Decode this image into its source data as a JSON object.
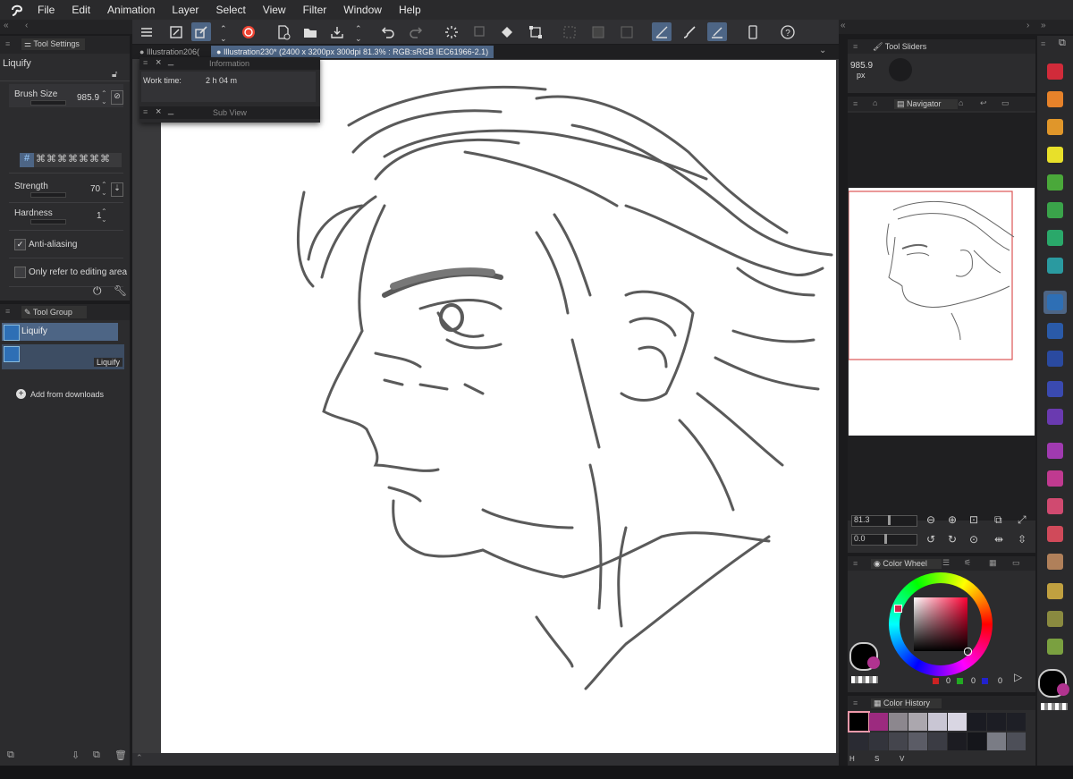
{
  "menu": {
    "items": [
      "File",
      "Edit",
      "Animation",
      "Layer",
      "Select",
      "View",
      "Filter",
      "Window",
      "Help"
    ]
  },
  "tabs": [
    {
      "label": "Illustration206(",
      "active": false
    },
    {
      "label": "Illustration230* (2400 x 3200px 300dpi 81.3% : RGB:sRGB IEC61966-2.1)",
      "active": true
    }
  ],
  "tool_settings": {
    "header": "Tool Settings",
    "tool_name": "Liquify",
    "brush_size_label": "Brush Size",
    "brush_size_value": "985.9",
    "strength_label": "Strength",
    "strength_value": "70",
    "hardness_label": "Hardness",
    "hardness_value": "1",
    "anti_aliasing_label": "Anti-aliasing",
    "anti_aliasing_checked": true,
    "editing_area_label": "Only refer to editing area",
    "editing_area_checked": false
  },
  "tool_group": {
    "header": "Tool Group",
    "item1": "Liquify",
    "item2": "Liquify",
    "add_downloads": "Add from downloads"
  },
  "information": {
    "header": "Information",
    "work_time_label": "Work time:",
    "work_time_value": "2 h 04 m",
    "sub_view": "Sub View"
  },
  "tool_sliders": {
    "header": "Tool Sliders",
    "value": "985.9",
    "unit": "px"
  },
  "navigator": {
    "header": "Navigator",
    "zoom": "81.3",
    "rotation": "0.0"
  },
  "color_wheel": {
    "header": "Color Wheel",
    "r": "0",
    "g": "0",
    "b": "0"
  },
  "color_history": {
    "header": "Color History",
    "hsv": [
      "H",
      "S",
      "V"
    ],
    "swatches": [
      "#000000",
      "#9c2a7f",
      "#8c878e",
      "#aba7ae",
      "#c9c6d4",
      "#d9d6e3",
      "#1a1b22",
      "#1c1d24",
      "#1e1f26",
      "#2a2b33",
      "#33343c",
      "#44454d",
      "#5b5c66",
      "#3b3c44",
      "#1c1c22",
      "#15161b",
      "#7a7c85",
      "#4d4f58"
    ]
  },
  "colors": {
    "accent": "#4d6585",
    "panel": "#2c2c2e",
    "main_color": "#000000",
    "sub_color": "#b0338f"
  }
}
